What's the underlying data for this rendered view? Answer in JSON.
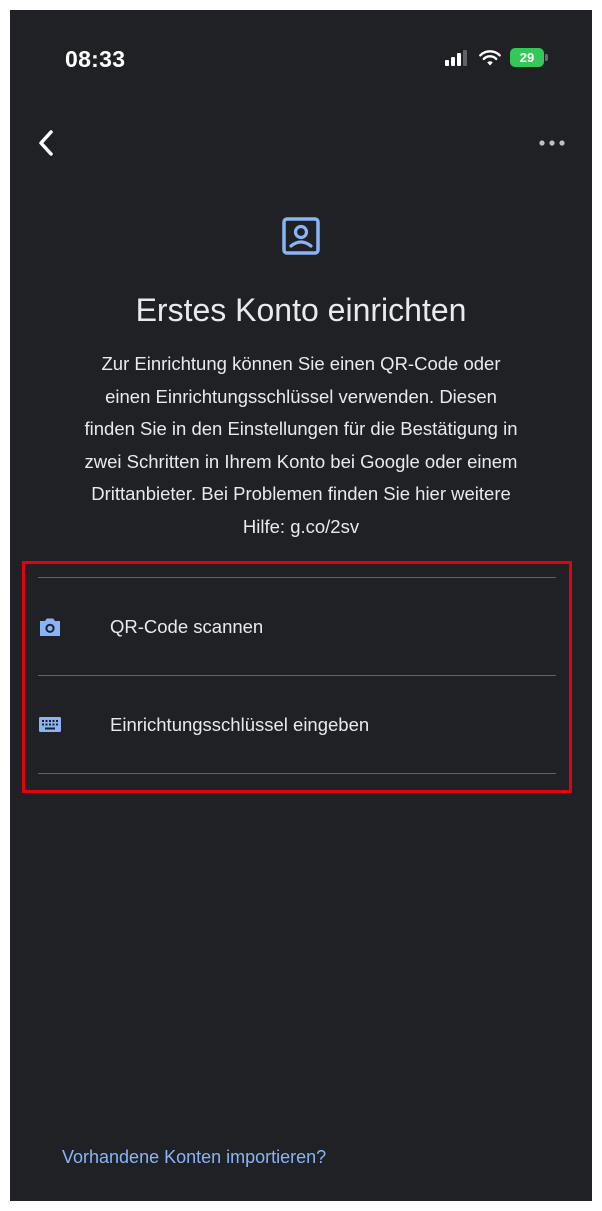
{
  "status_bar": {
    "time": "08:33",
    "battery": "29"
  },
  "nav": {
    "back_icon": "chevron-left-icon",
    "more_icon": "more-horizontal-icon"
  },
  "header": {
    "icon": "account-box-icon",
    "title": "Erstes Konto einrichten",
    "description_lines": [
      "Zur Einrichtung können Sie einen QR-Code oder",
      "einen Einrichtungsschlüssel verwenden. Diesen",
      "finden Sie in den Einstellungen für die Bestätigung in",
      "zwei Schritten in Ihrem Konto bei Google oder einem",
      "Drittanbieter. Bei Problemen finden Sie hier weitere",
      "Hilfe: g.co/2sv"
    ]
  },
  "options": [
    {
      "label": "QR-Code scannen",
      "icon": "camera-icon"
    },
    {
      "label": "Einrichtungsschlüssel eingeben",
      "icon": "keyboard-icon"
    }
  ],
  "footer": {
    "import_link": "Vorhandene Konten importieren?"
  },
  "colors": {
    "background": "#202124",
    "accent": "#8ab4f8",
    "highlight_border": "#e3000f",
    "battery": "#34c759"
  }
}
